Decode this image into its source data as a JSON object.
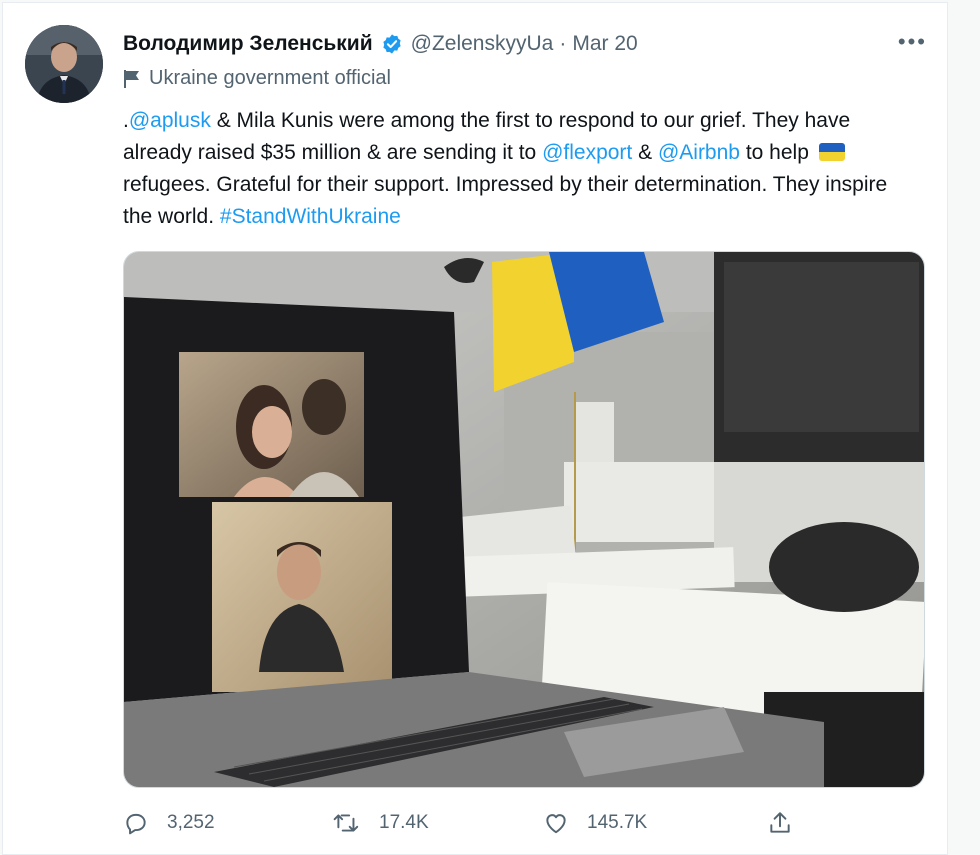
{
  "tweet": {
    "author_name": "Володимир Зеленський",
    "handle": "@ZelenskyyUa",
    "separator": "·",
    "date": "Mar 20",
    "more_label": "•••",
    "label": "Ukraine government official",
    "text": {
      "prefix": ".",
      "mention_1": "@aplusk",
      "part_1": " & Mila Kunis were among the first to respond to our grief. They have already raised $35 million & are sending it to ",
      "mention_2": "@flexport",
      "part_2": " & ",
      "mention_3": "@Airbnb",
      "part_3": " to help ",
      "part_4": " refugees. Grateful for their support. Impressed by their determination. They inspire the world. ",
      "hashtag": "#StandWithUkraine"
    },
    "stats": {
      "replies": "3,252",
      "retweets": "17.4K",
      "likes": "145.7K"
    }
  },
  "colors": {
    "accent": "#1d9bf0",
    "secondary_text": "#536471",
    "flag_blue": "#1f5fbf",
    "flag_yellow": "#f2d22e"
  },
  "icons": {
    "verified": "verified-badge-icon",
    "label": "flag-icon",
    "reply": "comment-icon",
    "retweet": "retweet-icon",
    "like": "heart-icon",
    "share": "share-icon",
    "more": "more-icon"
  }
}
